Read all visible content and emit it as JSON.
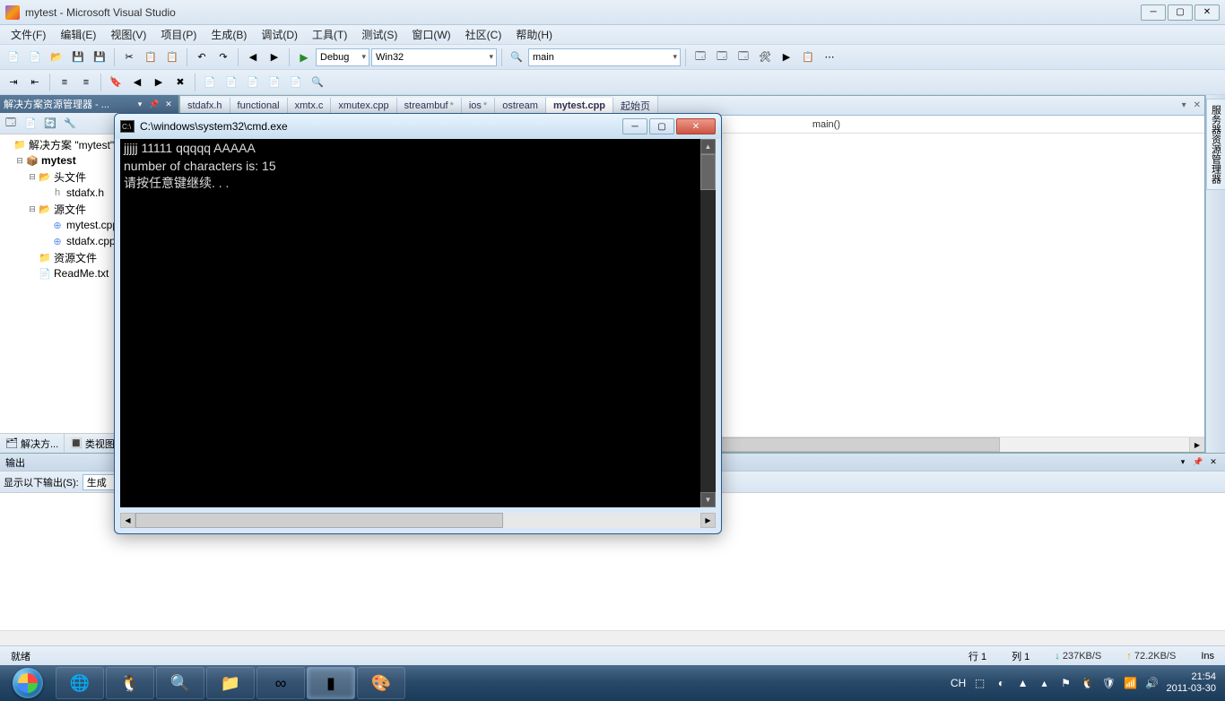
{
  "titlebar": {
    "title": "mytest - Microsoft Visual Studio"
  },
  "menu": {
    "file": "文件(F)",
    "edit": "编辑(E)",
    "view": "视图(V)",
    "project": "项目(P)",
    "build": "生成(B)",
    "debug": "调试(D)",
    "tools": "工具(T)",
    "test": "测试(S)",
    "window": "窗口(W)",
    "community": "社区(C)",
    "help": "帮助(H)"
  },
  "toolbar": {
    "config": "Debug",
    "platform": "Win32",
    "find": "main"
  },
  "solution_explorer": {
    "title": "解决方案资源管理器 - ...",
    "root": "解决方案 \"mytest\"",
    "project": "mytest",
    "folders": {
      "headers": "头文件",
      "sources": "源文件",
      "resources": "资源文件"
    },
    "files": {
      "stdafx_h": "stdafx.h",
      "mytest_cpp": "mytest.cpp",
      "stdafx_cpp": "stdafx.cpp",
      "readme": "ReadMe.txt"
    },
    "tabs": {
      "solution": "解决方... ",
      "classview": "类视图"
    }
  },
  "editor": {
    "tabs": [
      "stdafx.h",
      "functional",
      "xmtx.c",
      "xmutex.cpp",
      "streambuf",
      "ios",
      "ostream",
      "mytest.cpp",
      "起始页"
    ],
    "active_index": 7,
    "dirty": [
      false,
      false,
      false,
      false,
      true,
      true,
      false,
      false,
      false
    ],
    "crumb_scope": "main()"
  },
  "right_panel": {
    "server_explorer": "服务器资源管理器"
  },
  "output": {
    "title": "输出",
    "show_label": "显示以下输出(S):",
    "source": "生成"
  },
  "status": {
    "ready": "就绪",
    "row_label": "行",
    "row": "1",
    "col_label": "列",
    "col": "1",
    "up": "237KB/S",
    "dn": "72.2KB/S",
    "ins": "Ins"
  },
  "cmd": {
    "title": "C:\\windows\\system32\\cmd.exe",
    "lines": [
      "jjjjj 11111 qqqqq AAAAA",
      "number of characters is: 15",
      "请按任意键继续. . ."
    ]
  },
  "taskbar": {
    "lang": "CH",
    "time": "21:54",
    "date": "2011-03-30"
  }
}
